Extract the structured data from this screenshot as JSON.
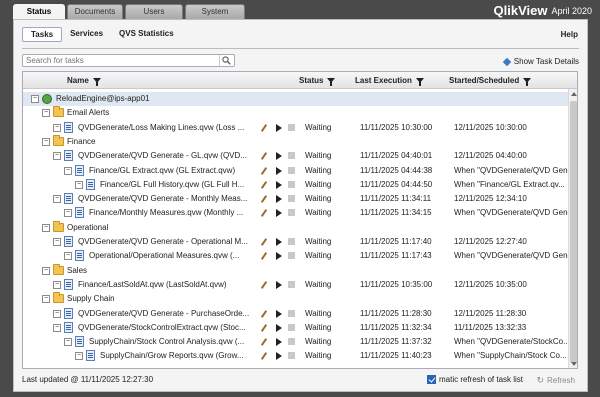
{
  "top_tabs": [
    {
      "label": "Status",
      "active": true
    },
    {
      "label": "Documents",
      "active": false
    },
    {
      "label": "Users",
      "active": false
    },
    {
      "label": "System",
      "active": false
    }
  ],
  "brand": {
    "logo_left": "Qlik",
    "logo_right": "View",
    "version": "April 2020"
  },
  "sub_tabs": [
    {
      "label": "Tasks",
      "active": true
    },
    {
      "label": "Services",
      "active": false
    },
    {
      "label": "QVS Statistics",
      "active": false
    }
  ],
  "help_label": "Help",
  "search": {
    "placeholder": "Search for tasks",
    "value": ""
  },
  "show_task_details": "Show Task Details",
  "columns": {
    "name": "Name",
    "status": "Status",
    "last_execution": "Last Execution",
    "started_scheduled": "Started/Scheduled"
  },
  "rows": [
    {
      "level": 0,
      "kind": "engine",
      "name": "ReloadEngine@ips-app01",
      "status": "",
      "last": "",
      "next": ""
    },
    {
      "level": 1,
      "kind": "folder",
      "name": "Email Alerts",
      "status": "",
      "last": "",
      "next": ""
    },
    {
      "level": 2,
      "kind": "task",
      "name": "QVDGenerate/Loss Making Lines.qvw (Loss ...",
      "status": "Waiting",
      "last": "11/11/2025 10:30:00",
      "next": "12/11/2025 10:30:00"
    },
    {
      "level": 1,
      "kind": "folder",
      "name": "Finance",
      "status": "",
      "last": "",
      "next": ""
    },
    {
      "level": 2,
      "kind": "task",
      "name": "QVDGenerate/QVD Generate - GL.qvw (QVD...",
      "status": "Waiting",
      "last": "11/11/2025 04:40:01",
      "next": "12/11/2025 04:40:00"
    },
    {
      "level": 3,
      "kind": "task",
      "name": "Finance/GL Extract.qvw (GL Extract.qvw)",
      "status": "Waiting",
      "last": "11/11/2025 04:44:38",
      "next": "When \"QVDGenerate/QVD Gene"
    },
    {
      "level": 4,
      "kind": "task",
      "name": "Finance/GL Full History.qvw (GL Full H...",
      "status": "Waiting",
      "last": "11/11/2025 04:44:50",
      "next": "When \"Finance/GL Extract.qv..."
    },
    {
      "level": 2,
      "kind": "task",
      "name": "QVDGenerate/QVD Generate - Monthly Meas...",
      "status": "Waiting",
      "last": "11/11/2025 11:34:11",
      "next": "12/11/2025 12:34:10"
    },
    {
      "level": 3,
      "kind": "task",
      "name": "Finance/Monthly Measures.qvw (Monthly ...",
      "status": "Waiting",
      "last": "11/11/2025 11:34:15",
      "next": "When \"QVDGenerate/QVD Gene"
    },
    {
      "level": 1,
      "kind": "folder",
      "name": "Operational",
      "status": "",
      "last": "",
      "next": ""
    },
    {
      "level": 2,
      "kind": "task",
      "name": "QVDGenerate/QVD Generate - Operational M...",
      "status": "Waiting",
      "last": "11/11/2025 11:17:40",
      "next": "12/11/2025 12:27:40"
    },
    {
      "level": 3,
      "kind": "task",
      "name": "Operational/Operational Measures.qvw (...",
      "status": "Waiting",
      "last": "11/11/2025 11:17:43",
      "next": "When \"QVDGenerate/QVD Gene"
    },
    {
      "level": 1,
      "kind": "folder",
      "name": "Sales",
      "status": "",
      "last": "",
      "next": ""
    },
    {
      "level": 2,
      "kind": "task",
      "name": "Finance/LastSoldAt.qvw (LastSoldAt.qvw)",
      "status": "Waiting",
      "last": "11/11/2025 10:35:00",
      "next": "12/11/2025 10:35:00"
    },
    {
      "level": 1,
      "kind": "folder",
      "name": "Supply Chain",
      "status": "",
      "last": "",
      "next": ""
    },
    {
      "level": 2,
      "kind": "task",
      "name": "QVDGenerate/QVD Generate - PurchaseOrde...",
      "status": "Waiting",
      "last": "11/11/2025 11:28:30",
      "next": "12/11/2025 11:28:30"
    },
    {
      "level": 2,
      "kind": "task",
      "name": "QVDGenerate/StockControlExtract.qvw (Stoc...",
      "status": "Waiting",
      "last": "11/11/2025 11:32:34",
      "next": "11/11/2025 13:32:33"
    },
    {
      "level": 3,
      "kind": "task",
      "name": "SupplyChain/Stock Control Analysis.qvw (...",
      "status": "Waiting",
      "last": "11/11/2025 11:37:32",
      "next": "When \"QVDGenerate/StockCo..."
    },
    {
      "level": 4,
      "kind": "task",
      "name": "SupplyChain/Grow Reports.qvw (Grow...",
      "status": "Waiting",
      "last": "11/11/2025 11:40:23",
      "next": "When \"SupplyChain/Stock Co..."
    }
  ],
  "footer": {
    "last_updated": "Last updated @ 11/11/2025 12:27:30",
    "auto_refresh_label": "matic refresh of task list",
    "auto_refresh_checked": true,
    "refresh_label": "Refresh"
  }
}
